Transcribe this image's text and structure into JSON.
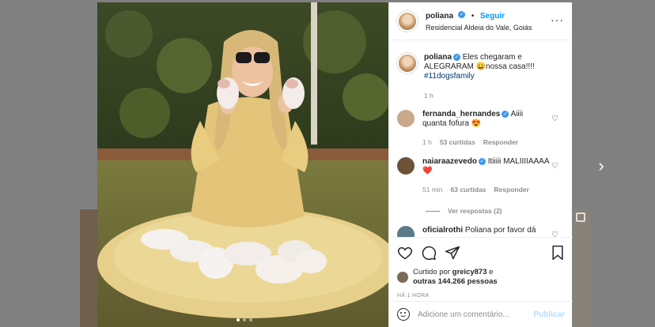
{
  "post": {
    "username": "poliana",
    "verified_mark": "✓",
    "follow_label": "Seguir",
    "separator": "•",
    "location": "Residencial Aldeia do Vale, Goiás",
    "more_label": "···"
  },
  "caption": {
    "username": "poliana",
    "text": " Eles chegaram e ALEGRARAM 😀nossa casa!!!!",
    "hashtag": "#11dogsfamily",
    "time": "1 h"
  },
  "comments": [
    {
      "username": "fernanda_hernandes",
      "text": " Aiiii quanta fofura 😍",
      "time": "1 h",
      "likes": "53 curtidas",
      "reply": "Responder",
      "avatar_color": "#c9a98a"
    },
    {
      "username": "naiaraazevedo",
      "text": " Itiiiii MALIIIIAAAA ❤️",
      "time": "51 min",
      "likes": "63 curtidas",
      "reply": "Responder",
      "avatar_color": "#6b5238",
      "replies_label": "Ver respostas (2)"
    },
    {
      "username": "oficialrothi",
      "text": " Poliana por favor dá",
      "avatar_color": "#5b7a8a"
    }
  ],
  "likes": {
    "prefix": "Curtido por ",
    "user": "greicy873",
    "middle": " e",
    "others": "outras 144.266 pessoas"
  },
  "timestamp": "HÁ 1 HORA",
  "add_comment": {
    "placeholder": "Adicione um comentário...",
    "publish_label": "Publicar"
  },
  "nav": {
    "next_arrow": "›",
    "photo_next": "›"
  },
  "colors": {
    "accent": "#0095f6",
    "verified": "#3897f0",
    "publish_disabled": "#b2dffc",
    "hashtag": "#00376b"
  }
}
